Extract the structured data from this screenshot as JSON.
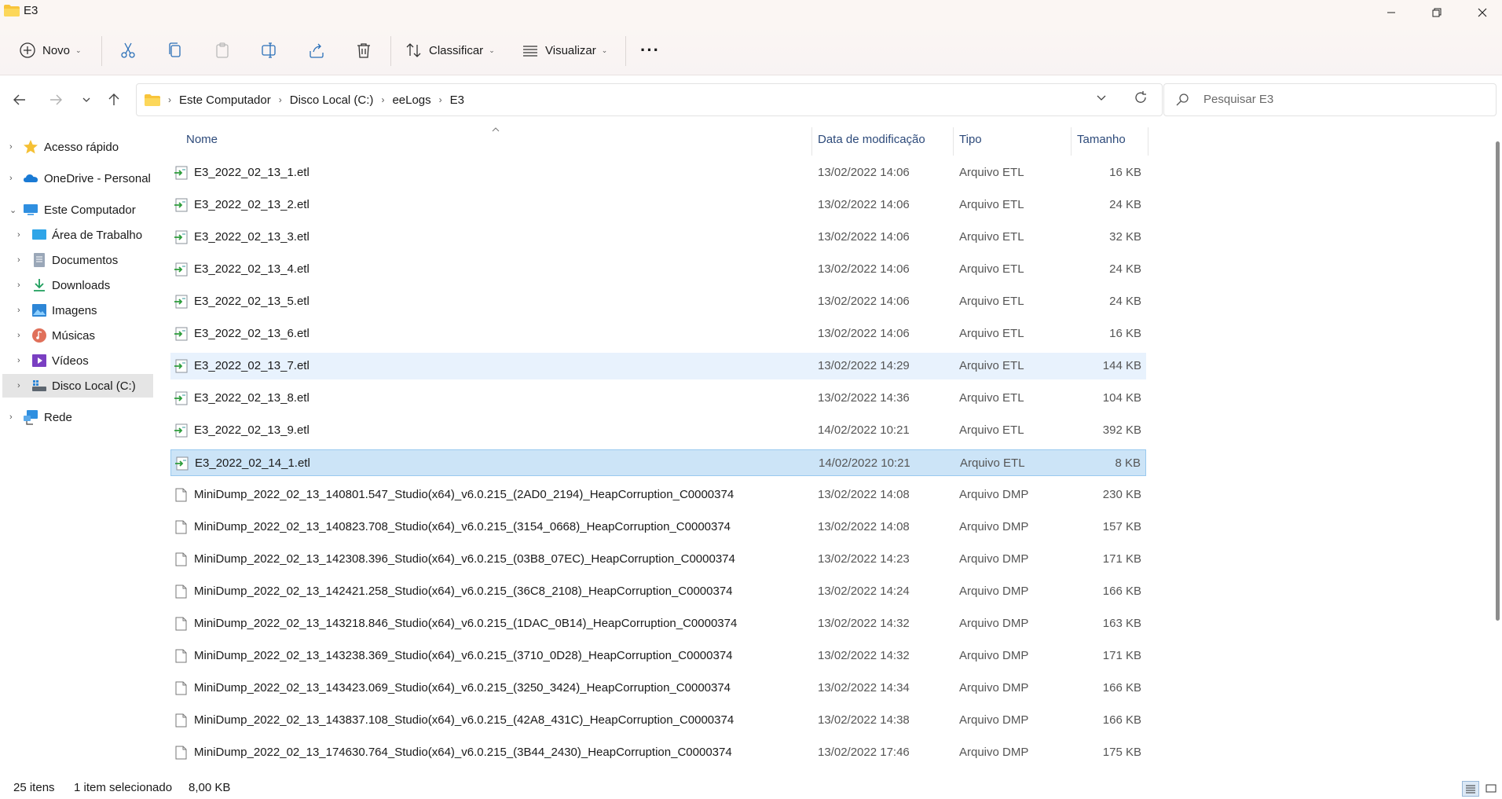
{
  "window": {
    "title": "E3"
  },
  "toolbar": {
    "new_label": "Novo",
    "sort_label": "Classificar",
    "view_label": "Visualizar",
    "more_label": "···"
  },
  "address": {
    "crumbs": [
      "Este Computador",
      "Disco Local (C:)",
      "eeLogs",
      "E3"
    ]
  },
  "search": {
    "placeholder": "Pesquisar E3"
  },
  "sidebar": {
    "items": [
      {
        "label": "Acesso rápido"
      },
      {
        "label": "OneDrive - Personal"
      },
      {
        "label": "Este Computador"
      },
      {
        "label": "Área de Trabalho"
      },
      {
        "label": "Documentos"
      },
      {
        "label": "Downloads"
      },
      {
        "label": "Imagens"
      },
      {
        "label": "Músicas"
      },
      {
        "label": "Vídeos"
      },
      {
        "label": "Disco Local (C:)"
      },
      {
        "label": "Rede"
      }
    ]
  },
  "columns": {
    "name": "Nome",
    "date": "Data de modificação",
    "type": "Tipo",
    "size": "Tamanho"
  },
  "files": [
    {
      "name": "E3_2022_02_13_1.etl",
      "date": "13/02/2022 14:06",
      "type": "Arquivo ETL",
      "size": "16 KB",
      "kind": "etl"
    },
    {
      "name": "E3_2022_02_13_2.etl",
      "date": "13/02/2022 14:06",
      "type": "Arquivo ETL",
      "size": "24 KB",
      "kind": "etl"
    },
    {
      "name": "E3_2022_02_13_3.etl",
      "date": "13/02/2022 14:06",
      "type": "Arquivo ETL",
      "size": "32 KB",
      "kind": "etl"
    },
    {
      "name": "E3_2022_02_13_4.etl",
      "date": "13/02/2022 14:06",
      "type": "Arquivo ETL",
      "size": "24 KB",
      "kind": "etl"
    },
    {
      "name": "E3_2022_02_13_5.etl",
      "date": "13/02/2022 14:06",
      "type": "Arquivo ETL",
      "size": "24 KB",
      "kind": "etl"
    },
    {
      "name": "E3_2022_02_13_6.etl",
      "date": "13/02/2022 14:06",
      "type": "Arquivo ETL",
      "size": "16 KB",
      "kind": "etl"
    },
    {
      "name": "E3_2022_02_13_7.etl",
      "date": "13/02/2022 14:29",
      "type": "Arquivo ETL",
      "size": "144 KB",
      "kind": "etl"
    },
    {
      "name": "E3_2022_02_13_8.etl",
      "date": "13/02/2022 14:36",
      "type": "Arquivo ETL",
      "size": "104 KB",
      "kind": "etl"
    },
    {
      "name": "E3_2022_02_13_9.etl",
      "date": "14/02/2022 10:21",
      "type": "Arquivo ETL",
      "size": "392 KB",
      "kind": "etl"
    },
    {
      "name": "E3_2022_02_14_1.etl",
      "date": "14/02/2022 10:21",
      "type": "Arquivo ETL",
      "size": "8 KB",
      "kind": "etl"
    },
    {
      "name": "MiniDump_2022_02_13_140801.547_Studio(x64)_v6.0.215_(2AD0_2194)_HeapCorruption_C0000374",
      "date": "13/02/2022 14:08",
      "type": "Arquivo DMP",
      "size": "230 KB",
      "kind": "dmp"
    },
    {
      "name": "MiniDump_2022_02_13_140823.708_Studio(x64)_v6.0.215_(3154_0668)_HeapCorruption_C0000374",
      "date": "13/02/2022 14:08",
      "type": "Arquivo DMP",
      "size": "157 KB",
      "kind": "dmp"
    },
    {
      "name": "MiniDump_2022_02_13_142308.396_Studio(x64)_v6.0.215_(03B8_07EC)_HeapCorruption_C0000374",
      "date": "13/02/2022 14:23",
      "type": "Arquivo DMP",
      "size": "171 KB",
      "kind": "dmp"
    },
    {
      "name": "MiniDump_2022_02_13_142421.258_Studio(x64)_v6.0.215_(36C8_2108)_HeapCorruption_C0000374",
      "date": "13/02/2022 14:24",
      "type": "Arquivo DMP",
      "size": "166 KB",
      "kind": "dmp"
    },
    {
      "name": "MiniDump_2022_02_13_143218.846_Studio(x64)_v6.0.215_(1DAC_0B14)_HeapCorruption_C0000374",
      "date": "13/02/2022 14:32",
      "type": "Arquivo DMP",
      "size": "163 KB",
      "kind": "dmp"
    },
    {
      "name": "MiniDump_2022_02_13_143238.369_Studio(x64)_v6.0.215_(3710_0D28)_HeapCorruption_C0000374",
      "date": "13/02/2022 14:32",
      "type": "Arquivo DMP",
      "size": "171 KB",
      "kind": "dmp"
    },
    {
      "name": "MiniDump_2022_02_13_143423.069_Studio(x64)_v6.0.215_(3250_3424)_HeapCorruption_C0000374",
      "date": "13/02/2022 14:34",
      "type": "Arquivo DMP",
      "size": "166 KB",
      "kind": "dmp"
    },
    {
      "name": "MiniDump_2022_02_13_143837.108_Studio(x64)_v6.0.215_(42A8_431C)_HeapCorruption_C0000374",
      "date": "13/02/2022 14:38",
      "type": "Arquivo DMP",
      "size": "166 KB",
      "kind": "dmp"
    },
    {
      "name": "MiniDump_2022_02_13_174630.764_Studio(x64)_v6.0.215_(3B44_2430)_HeapCorruption_C0000374",
      "date": "13/02/2022 17:46",
      "type": "Arquivo DMP",
      "size": "175 KB",
      "kind": "dmp"
    }
  ],
  "hover_index": 6,
  "selected_index": 9,
  "status": {
    "count": "25 itens",
    "selected": "1 item selecionado",
    "size": "8,00 KB"
  },
  "colors": {
    "selected_bg": "#cce4f7",
    "hover_bg": "#e8f2fd",
    "column_header": "#2d4a7a",
    "folder_yellow": "#f8c43a"
  }
}
